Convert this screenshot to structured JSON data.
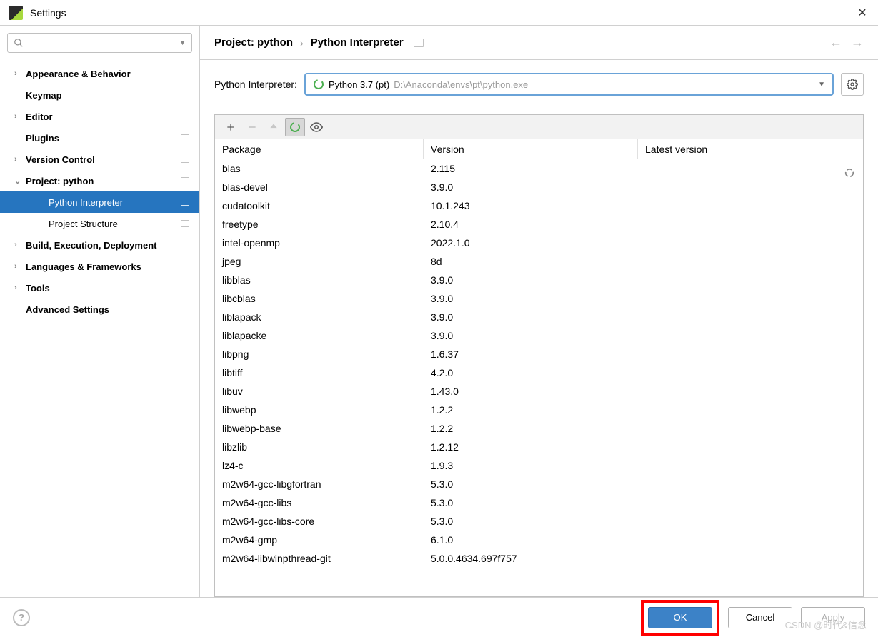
{
  "window": {
    "title": "Settings"
  },
  "search": {
    "placeholder": ""
  },
  "sidebar": {
    "items": [
      {
        "label": "Appearance & Behavior",
        "bold": true,
        "arrow": ">",
        "badge": false
      },
      {
        "label": "Keymap",
        "bold": true,
        "arrow": "",
        "badge": false
      },
      {
        "label": "Editor",
        "bold": true,
        "arrow": ">",
        "badge": false
      },
      {
        "label": "Plugins",
        "bold": true,
        "arrow": "",
        "badge": true
      },
      {
        "label": "Version Control",
        "bold": true,
        "arrow": ">",
        "badge": true
      },
      {
        "label": "Project: python",
        "bold": true,
        "arrow": "v",
        "badge": true
      },
      {
        "label": "Python Interpreter",
        "bold": false,
        "arrow": "",
        "badge": true,
        "child": true,
        "selected": true
      },
      {
        "label": "Project Structure",
        "bold": false,
        "arrow": "",
        "badge": true,
        "child": true
      },
      {
        "label": "Build, Execution, Deployment",
        "bold": true,
        "arrow": ">",
        "badge": false
      },
      {
        "label": "Languages & Frameworks",
        "bold": true,
        "arrow": ">",
        "badge": false
      },
      {
        "label": "Tools",
        "bold": true,
        "arrow": ">",
        "badge": false
      },
      {
        "label": "Advanced Settings",
        "bold": true,
        "arrow": "",
        "badge": false
      }
    ]
  },
  "breadcrumb": {
    "part1": "Project: python",
    "part2": "Python Interpreter"
  },
  "interpreter": {
    "label": "Python Interpreter:",
    "name": "Python 3.7 (pt)",
    "path": "D:\\Anaconda\\envs\\pt\\python.exe"
  },
  "packages": {
    "columns": {
      "c1": "Package",
      "c2": "Version",
      "c3": "Latest version"
    },
    "rows": [
      {
        "name": "blas",
        "version": "2.115"
      },
      {
        "name": "blas-devel",
        "version": "3.9.0"
      },
      {
        "name": "cudatoolkit",
        "version": "10.1.243"
      },
      {
        "name": "freetype",
        "version": "2.10.4"
      },
      {
        "name": "intel-openmp",
        "version": "2022.1.0"
      },
      {
        "name": "jpeg",
        "version": "8d"
      },
      {
        "name": "libblas",
        "version": "3.9.0"
      },
      {
        "name": "libcblas",
        "version": "3.9.0"
      },
      {
        "name": "liblapack",
        "version": "3.9.0"
      },
      {
        "name": "liblapacke",
        "version": "3.9.0"
      },
      {
        "name": "libpng",
        "version": "1.6.37"
      },
      {
        "name": "libtiff",
        "version": "4.2.0"
      },
      {
        "name": "libuv",
        "version": "1.43.0"
      },
      {
        "name": "libwebp",
        "version": "1.2.2"
      },
      {
        "name": "libwebp-base",
        "version": "1.2.2"
      },
      {
        "name": "libzlib",
        "version": "1.2.12"
      },
      {
        "name": "lz4-c",
        "version": "1.9.3"
      },
      {
        "name": "m2w64-gcc-libgfortran",
        "version": "5.3.0"
      },
      {
        "name": "m2w64-gcc-libs",
        "version": "5.3.0"
      },
      {
        "name": "m2w64-gcc-libs-core",
        "version": "5.3.0"
      },
      {
        "name": "m2w64-gmp",
        "version": "6.1.0"
      },
      {
        "name": "m2w64-libwinpthread-git",
        "version": "5.0.0.4634.697f757"
      }
    ]
  },
  "footer": {
    "ok": "OK",
    "cancel": "Cancel",
    "apply": "Apply"
  },
  "watermark": "CSDN @时代&信念"
}
